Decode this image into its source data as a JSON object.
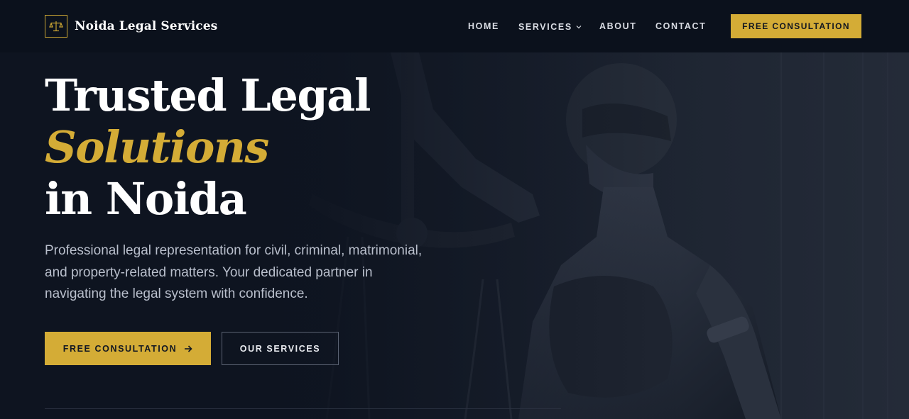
{
  "header": {
    "brand_name": "Noida Legal Services",
    "logo_icon": "scales-of-justice-icon",
    "nav": [
      {
        "label": "HOME"
      },
      {
        "label": "SERVICES",
        "has_dropdown": true
      },
      {
        "label": "ABOUT"
      },
      {
        "label": "CONTACT"
      }
    ],
    "cta_label": "FREE CONSULTATION"
  },
  "hero": {
    "title_line1": "Trusted Legal",
    "title_accent": "Solutions",
    "title_line3": "in Noida",
    "description": "Professional legal representation for civil, criminal, matrimonial, and property-related matters. Your dedicated partner in navigating the legal system with confidence.",
    "primary_button": "FREE CONSULTATION",
    "primary_button_icon": "arrow-right-icon",
    "secondary_button": "OUR SERVICES",
    "background_image": "lady-justice-statue"
  },
  "colors": {
    "accent_gold": "#d4ac36",
    "navy_dark": "#0b111c",
    "background": "#0e1420",
    "text_muted": "#b9bfcc"
  }
}
